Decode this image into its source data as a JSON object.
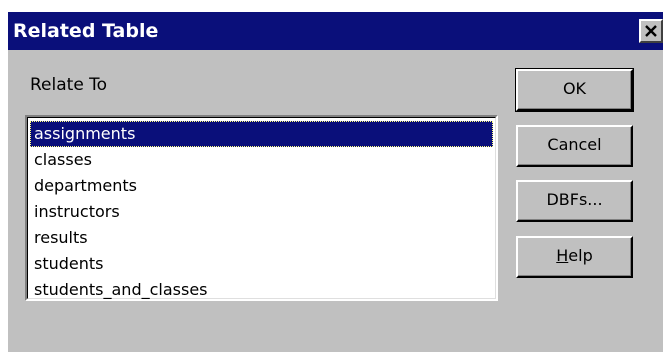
{
  "window": {
    "title": "Related Table",
    "close_glyph": "×"
  },
  "relate_to": {
    "label": "Relate To",
    "items": [
      "assignments",
      "classes",
      "departments",
      "instructors",
      "results",
      "students",
      "students_and_classes"
    ],
    "selected": "assignments"
  },
  "buttons": {
    "ok": "OK",
    "cancel": "Cancel",
    "dbfs": "DBFs...",
    "help_mnemonic": "H",
    "help_rest": "elp"
  },
  "colors": {
    "titlebar": "#0a0f7a",
    "face": "#c0c0c0",
    "selection": "#0a0f7a"
  }
}
